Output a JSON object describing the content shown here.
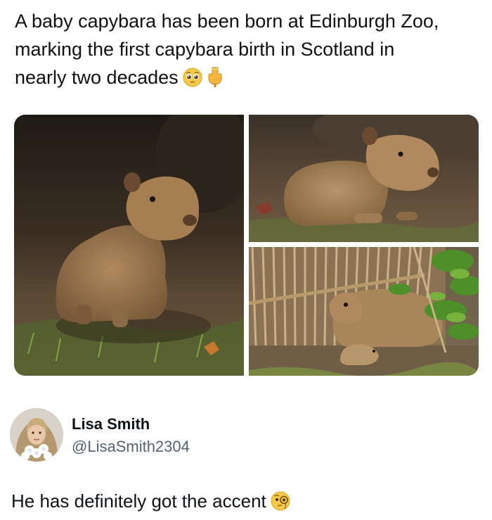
{
  "post": {
    "line1": "A baby capybara has been born at Edinburgh Zoo,",
    "line2": "marking the first capybara birth in Scotland in",
    "line3": "nearly two decades",
    "emojis": [
      "pleading-face-icon",
      "backhand-index-pointing-down-icon"
    ]
  },
  "media": {
    "photos": [
      "capybara-pup-on-grass",
      "capybara-pup-lying-on-ground",
      "capybara-adult-and-pup-under-straw-shelter"
    ]
  },
  "reply": {
    "display_name": "Lisa Smith",
    "handle": "@LisaSmith2304",
    "text": "He has definitely got the accent",
    "emoji": "face-with-monocle-icon"
  },
  "colors": {
    "text": "#0f1419",
    "secondary_text": "#536471",
    "background": "#ffffff"
  }
}
